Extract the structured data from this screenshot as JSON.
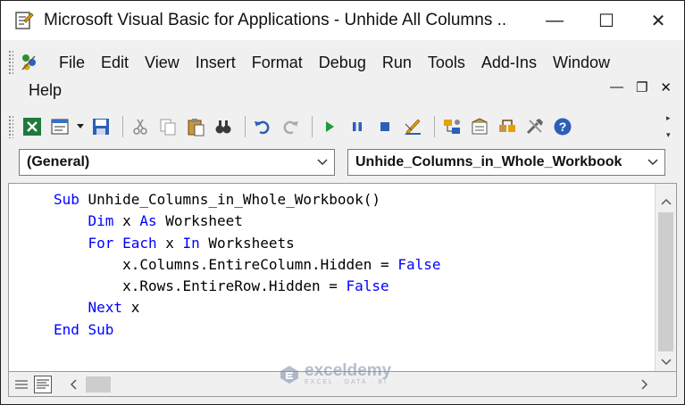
{
  "window": {
    "title": "Microsoft Visual Basic for Applications - Unhide All Columns ...",
    "minimize": "—",
    "maximize": "☐",
    "close": "✕"
  },
  "menu": {
    "items": [
      "File",
      "Edit",
      "View",
      "Insert",
      "Format",
      "Debug",
      "Run",
      "Tools",
      "Add-Ins",
      "Window"
    ],
    "help": "Help",
    "mdi_minimize": "—",
    "mdi_restore": "❐",
    "mdi_close": "✕"
  },
  "toolbar": {
    "icons": [
      "excel-view-icon",
      "insert-module-icon",
      "save-icon",
      "cut-icon",
      "copy-icon",
      "paste-icon",
      "find-icon",
      "undo-icon",
      "redo-icon",
      "run-icon",
      "break-icon",
      "reset-icon",
      "design-mode-icon",
      "project-explorer-icon",
      "properties-icon",
      "object-browser-icon",
      "toolbox-icon",
      "help-icon"
    ]
  },
  "combos": {
    "object": "(General)",
    "procedure": "Unhide_Columns_in_Whole_Workbook"
  },
  "code": {
    "lines": [
      [
        {
          "t": "Sub ",
          "k": true
        },
        {
          "t": "Unhide_Columns_in_Whole_Workbook()",
          "k": false
        }
      ],
      [
        {
          "t": "    ",
          "k": false
        },
        {
          "t": "Dim ",
          "k": true
        },
        {
          "t": "x ",
          "k": false
        },
        {
          "t": "As ",
          "k": true
        },
        {
          "t": "Worksheet",
          "k": false
        }
      ],
      [
        {
          "t": "    ",
          "k": false
        },
        {
          "t": "For Each ",
          "k": true
        },
        {
          "t": "x ",
          "k": false
        },
        {
          "t": "In ",
          "k": true
        },
        {
          "t": "Worksheets",
          "k": false
        }
      ],
      [
        {
          "t": "        x.Columns.EntireColumn.Hidden = ",
          "k": false
        },
        {
          "t": "False",
          "k": true
        }
      ],
      [
        {
          "t": "        x.Rows.EntireRow.Hidden = ",
          "k": false
        },
        {
          "t": "False",
          "k": true
        }
      ],
      [
        {
          "t": "    ",
          "k": false
        },
        {
          "t": "Next ",
          "k": true
        },
        {
          "t": "x",
          "k": false
        }
      ],
      [
        {
          "t": "End Sub",
          "k": true
        }
      ]
    ]
  },
  "watermark": {
    "brand": "exceldemy",
    "tagline": "EXCEL · DATA · BI"
  },
  "colors": {
    "keyword": "#0000ff",
    "text": "#000000",
    "chrome": "#f0f0f0"
  }
}
